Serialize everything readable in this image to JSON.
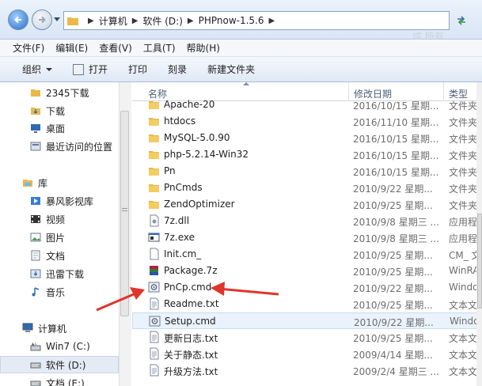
{
  "address": {
    "crumbs": [
      "计算机",
      "软件 (D:)",
      "PHPnow-1.5.6"
    ],
    "search_hint": "成 所有"
  },
  "menubar": [
    "文件(F)",
    "编辑(E)",
    "查看(V)",
    "工具(T)",
    "帮助(H)"
  ],
  "toolbar": {
    "organize": "组织",
    "open": "打开",
    "print": "打印",
    "burn": "刻录",
    "new_folder": "新建文件夹"
  },
  "nav": {
    "items": [
      {
        "label": "2345下载",
        "icon": "folder-icon"
      },
      {
        "label": "下载",
        "icon": "download-folder-icon"
      },
      {
        "label": "桌面",
        "icon": "desktop-icon"
      },
      {
        "label": "最近访问的位置",
        "icon": "recent-places-icon"
      },
      {
        "label": "库",
        "icon": "library-icon"
      },
      {
        "label": "暴风影视库",
        "icon": "video-library-icon"
      },
      {
        "label": "视频",
        "icon": "video-icon"
      },
      {
        "label": "图片",
        "icon": "pictures-icon"
      },
      {
        "label": "文档",
        "icon": "documents-icon"
      },
      {
        "label": "迅雷下载",
        "icon": "thunder-download-icon"
      },
      {
        "label": "音乐",
        "icon": "music-icon"
      },
      {
        "label": "计算机",
        "icon": "computer-icon"
      },
      {
        "label": "Win7 (C:)",
        "icon": "drive-c-icon"
      },
      {
        "label": "软件 (D:)",
        "icon": "drive-d-icon"
      },
      {
        "label": "文档 (E:)",
        "icon": "drive-e-icon"
      }
    ]
  },
  "columns": {
    "name": "名称",
    "date": "修改日期",
    "type": "类型"
  },
  "files": [
    {
      "name": "Apache-20",
      "date": "2016/10/15 星期...",
      "type": "文件夹",
      "kind": "folder"
    },
    {
      "name": "htdocs",
      "date": "2016/11/10 星期...",
      "type": "文件夹",
      "kind": "folder"
    },
    {
      "name": "MySQL-5.0.90",
      "date": "2016/10/15 星期...",
      "type": "文件夹",
      "kind": "folder"
    },
    {
      "name": "php-5.2.14-Win32",
      "date": "2016/10/15 星期...",
      "type": "文件夹",
      "kind": "folder"
    },
    {
      "name": "Pn",
      "date": "2016/10/15 星期...",
      "type": "文件夹",
      "kind": "folder"
    },
    {
      "name": "PnCmds",
      "date": "2010/9/22 星期...",
      "type": "文件夹",
      "kind": "folder"
    },
    {
      "name": "ZendOptimizer",
      "date": "2010/9/25 星期...",
      "type": "文件夹",
      "kind": "folder"
    },
    {
      "name": "7z.dll",
      "date": "2010/9/8 星期三 ...",
      "type": "应用程",
      "kind": "dll"
    },
    {
      "name": "7z.exe",
      "date": "2010/9/8 星期三 ...",
      "type": "应用程",
      "kind": "exe"
    },
    {
      "name": "Init.cm_",
      "date": "2010/9/25 星期...",
      "type": "CM_ 文",
      "kind": "file"
    },
    {
      "name": "Package.7z",
      "date": "2010/9/25 星期...",
      "type": "WinRA",
      "kind": "archive"
    },
    {
      "name": "PnCp.cmd",
      "date": "2010/9/22 星期...",
      "type": "Windo",
      "kind": "cmd"
    },
    {
      "name": "Readme.txt",
      "date": "2010/9/25 星期...",
      "type": "文本文",
      "kind": "txt"
    },
    {
      "name": "Setup.cmd",
      "date": "2010/9/22 星期...",
      "type": "Windo",
      "kind": "cmd",
      "highlight": true
    },
    {
      "name": "更新日志.txt",
      "date": "2010/9/25 星期...",
      "type": "文本文",
      "kind": "txt"
    },
    {
      "name": "关于静态.txt",
      "date": "2009/4/14 星期...",
      "type": "文本文",
      "kind": "txt"
    },
    {
      "name": "升级方法.txt",
      "date": "2009/2/4 星期三 ...",
      "type": "文本文",
      "kind": "txt"
    }
  ],
  "colors": {
    "arrow": "#e0352b",
    "folder": "#e9b949",
    "selected": "#e4ebf4"
  }
}
